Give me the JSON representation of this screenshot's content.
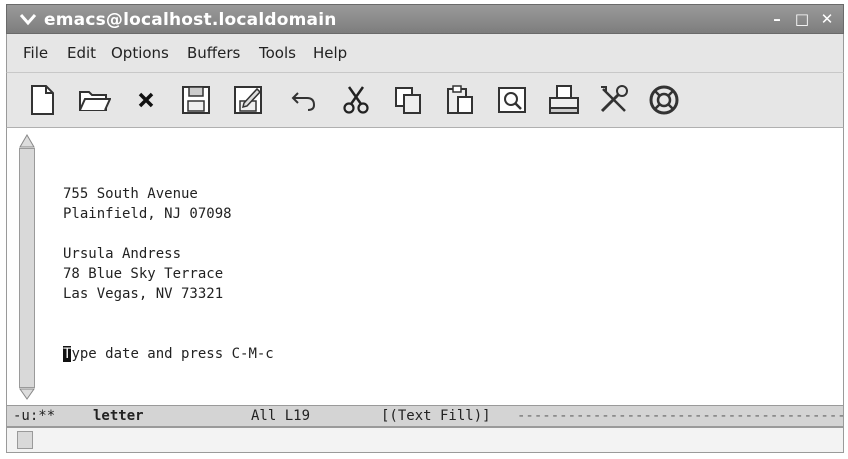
{
  "window": {
    "title": "emacs@localhost.localdomain"
  },
  "menu": {
    "items": [
      "File",
      "Edit",
      "Options",
      "Buffers",
      "Tools",
      "Help"
    ]
  },
  "toolbar": {
    "icons": [
      "new-file-icon",
      "open-folder-icon",
      "close-icon",
      "save-icon",
      "save-as-icon",
      "undo-icon",
      "cut-icon",
      "copy-icon",
      "paste-icon",
      "search-icon",
      "print-icon",
      "tools-icon",
      "help-lifebuoy-icon"
    ]
  },
  "buffer": {
    "lines": [
      "755 South Avenue",
      "Plainfield, NJ 07098",
      "",
      "Ursula Andress",
      "78 Blue Sky Terrace",
      "Las Vegas, NV 73321",
      "",
      ""
    ],
    "cursor_char": "T",
    "prompt_rest": "ype date and press C-M-c"
  },
  "modeline": {
    "status": "-u:**",
    "buffer_name": "letter",
    "position": "All L19",
    "mode": "[(Text Fill)]"
  }
}
